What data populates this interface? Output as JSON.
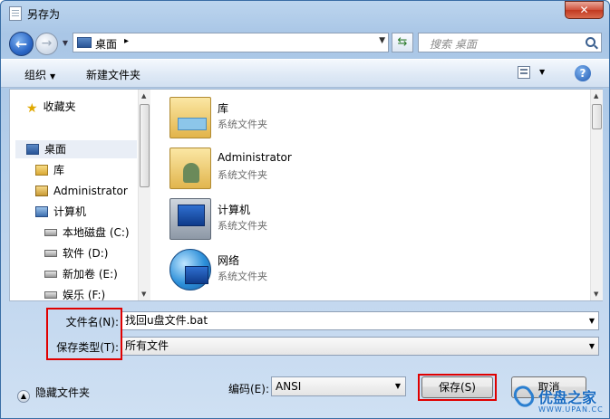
{
  "window": {
    "title": "另存为",
    "close_label": "✕"
  },
  "address": {
    "location": "桌面",
    "separator": "▸",
    "search_placeholder": "搜索 桌面"
  },
  "toolbar": {
    "organize": "组织",
    "new_folder": "新建文件夹",
    "help": "?"
  },
  "nav": {
    "items": [
      {
        "label": "收藏夹",
        "icon": "star-icon"
      },
      {
        "label": "桌面",
        "icon": "desktop-icon"
      },
      {
        "label": "库",
        "icon": "library-icon"
      },
      {
        "label": "Administrator",
        "icon": "user-folder-icon"
      },
      {
        "label": "计算机",
        "icon": "computer-icon"
      },
      {
        "label": "本地磁盘 (C:)",
        "icon": "drive-icon"
      },
      {
        "label": "软件 (D:)",
        "icon": "drive-icon"
      },
      {
        "label": "新加卷 (E:)",
        "icon": "drive-icon"
      },
      {
        "label": "娱乐 (F:)",
        "icon": "drive-icon"
      }
    ]
  },
  "files": [
    {
      "name": "库",
      "type": "系统文件夹",
      "icon": "library-icon"
    },
    {
      "name": "Administrator",
      "type": "系统文件夹",
      "icon": "user-folder-icon"
    },
    {
      "name": "计算机",
      "type": "系统文件夹",
      "icon": "computer-icon"
    },
    {
      "name": "网络",
      "type": "系统文件夹",
      "icon": "network-icon"
    }
  ],
  "form": {
    "filename_label": "文件名(N):",
    "filename_value": "找回u盘文件.bat",
    "filetype_label": "保存类型(T):",
    "filetype_value": "所有文件"
  },
  "footer": {
    "hide_folders": "隐藏文件夹",
    "encoding_label": "编码(E):",
    "encoding_value": "ANSI",
    "save": "保存(S)",
    "cancel": "取消"
  },
  "watermark": {
    "text": "优盘之家",
    "url": "WWW.UPAN.CC"
  },
  "colors": {
    "highlight_red": "#e00000",
    "accent_blue": "#2b67c6"
  }
}
